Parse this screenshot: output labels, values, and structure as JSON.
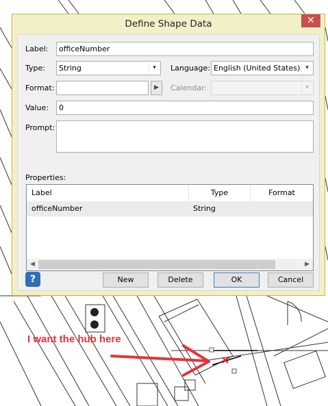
{
  "dialog": {
    "title": "Define Shape Data",
    "close_label": "✕",
    "label_caption": "Label:",
    "label_value": "officeNumber",
    "type_caption": "Type:",
    "type_value": "String",
    "language_caption": "Language:",
    "language_value": "English (United States)",
    "format_caption": "Format:",
    "format_value": "",
    "format_button": "▶",
    "calendar_caption": "Calendar:",
    "calendar_value": "",
    "value_caption": "Value:",
    "value_value": "0",
    "prompt_caption": "Prompt:",
    "prompt_value": "",
    "properties_caption": "Properties:",
    "properties": {
      "columns": [
        "Label",
        "Type",
        "Format"
      ],
      "rows": [
        {
          "label": "officeNumber",
          "type": "String",
          "format": ""
        }
      ]
    },
    "buttons": {
      "new": "New",
      "delete": "Delete",
      "ok": "OK",
      "cancel": "Cancel"
    },
    "help_icon_glyph": "?",
    "scroll_left_glyph": "◀",
    "scroll_right_glyph": "▶",
    "dropdown_glyph": "▾"
  },
  "annotation": {
    "text": "I want the hub here",
    "color": "#e8313b"
  },
  "icons": {
    "close": "close-icon",
    "help": "help-icon",
    "format_builder": "play-arrow-icon",
    "dropdown": "chevron-down-icon"
  },
  "colors": {
    "dialog_frame": "#f3f0c8",
    "close_button": "#c7504d",
    "default_button_border": "#3c7fb1"
  }
}
